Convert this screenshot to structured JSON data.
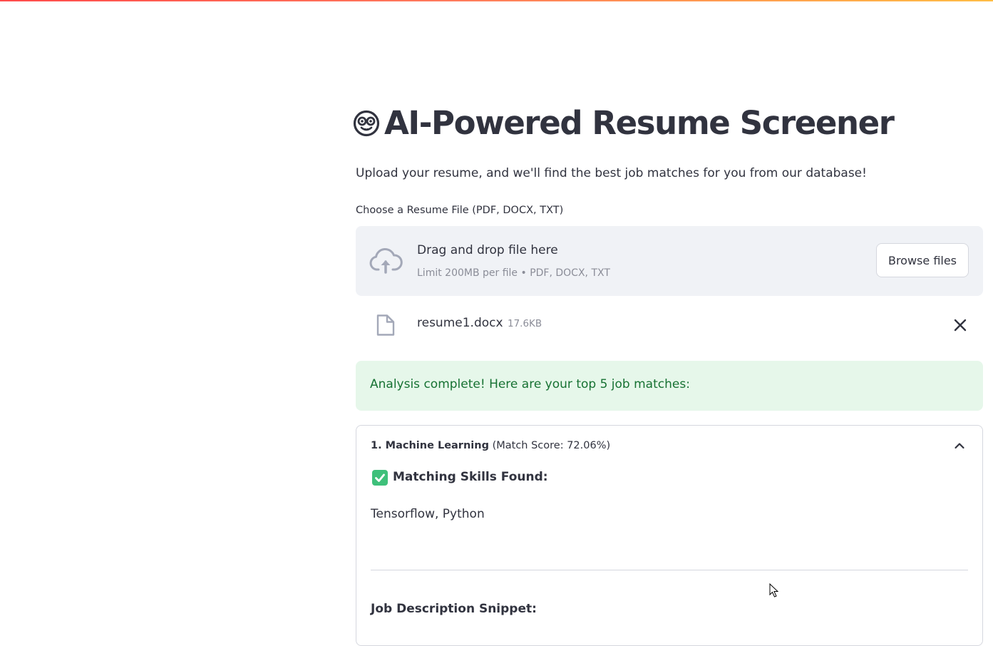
{
  "header": {
    "title": "AI-Powered Resume Screener",
    "title_icon": "nerd-face-icon",
    "subtitle": "Upload your resume, and we'll find the best job matches for you from our database!"
  },
  "uploader": {
    "label": "Choose a Resume File (PDF, DOCX, TXT)",
    "drop_title": "Drag and drop file here",
    "limit_text": "Limit 200MB per file • PDF, DOCX, TXT",
    "browse_label": "Browse files",
    "icon": "cloud-upload-icon"
  },
  "uploaded_file": {
    "name": "resume1.docx",
    "size": "17.6KB",
    "icon": "file-icon",
    "remove_icon": "close-icon"
  },
  "status": {
    "message": "Analysis complete! Here are your top 5 job matches:",
    "color": "#177233",
    "background": "#e6f7ea"
  },
  "results": {
    "items": [
      {
        "rank_title": "1. Machine Learning",
        "score_text": " (Match Score: 72.06%)",
        "expanded": true,
        "skills_heading": "Matching Skills Found:",
        "skills": "Tensorflow, Python",
        "snippet_heading": "Job Description Snippet:"
      }
    ]
  },
  "colors": {
    "accent_gradient_start": "#ff4b4b",
    "accent_gradient_end": "#ffbd45",
    "text": "#31333f",
    "muted": "#8b8d98",
    "check_green": "#3ec07a"
  }
}
